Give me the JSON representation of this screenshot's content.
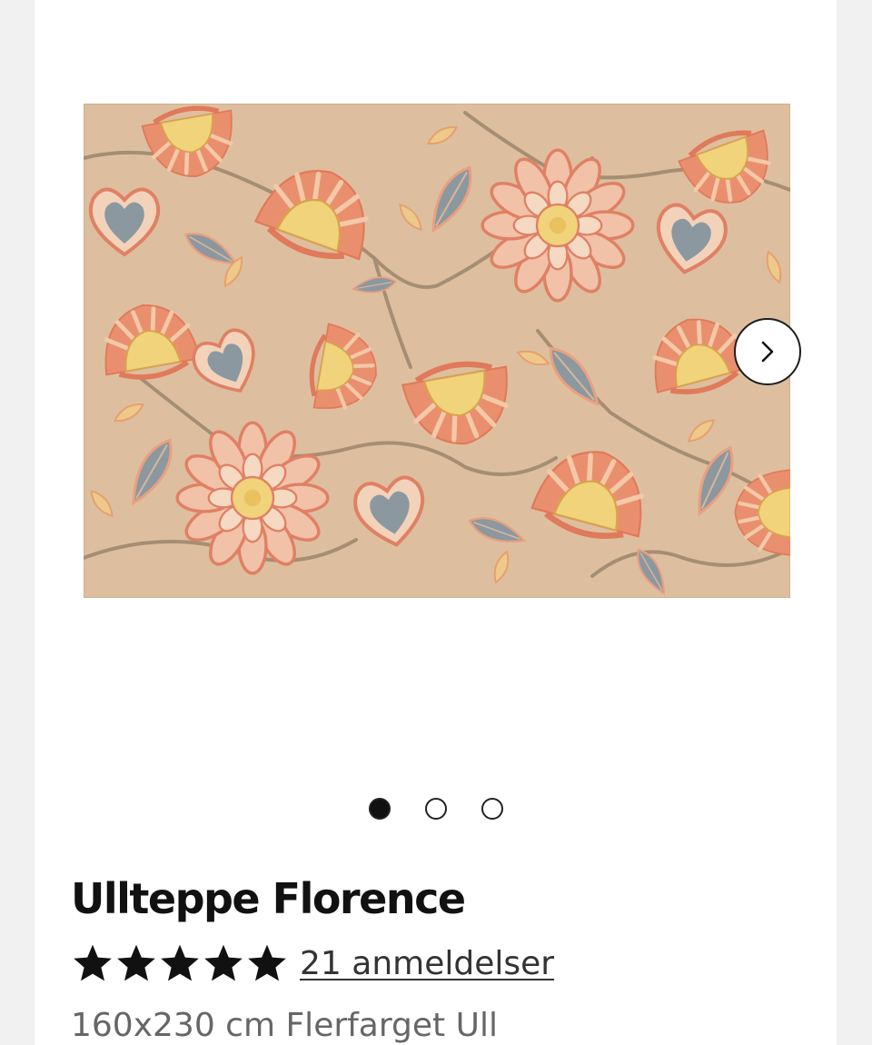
{
  "product": {
    "title": "Ullteppe Florence",
    "rating": {
      "stars": 5,
      "max_stars": 5,
      "reviews_label": "21 anmeldelser"
    },
    "subtitle": "160x230 cm Flerfarget Ull"
  },
  "gallery": {
    "image_count": 3,
    "active_index": 0,
    "next_icon": "chevron-right-icon"
  },
  "colors": {
    "rug_background": "#ddbf9f",
    "flower_coral": "#e4876a",
    "flower_yellow": "#f0d37a",
    "leaf_blue": "#8b98a0",
    "stem_brown": "#a58e73",
    "text_primary": "#111111",
    "text_secondary": "#666666"
  }
}
